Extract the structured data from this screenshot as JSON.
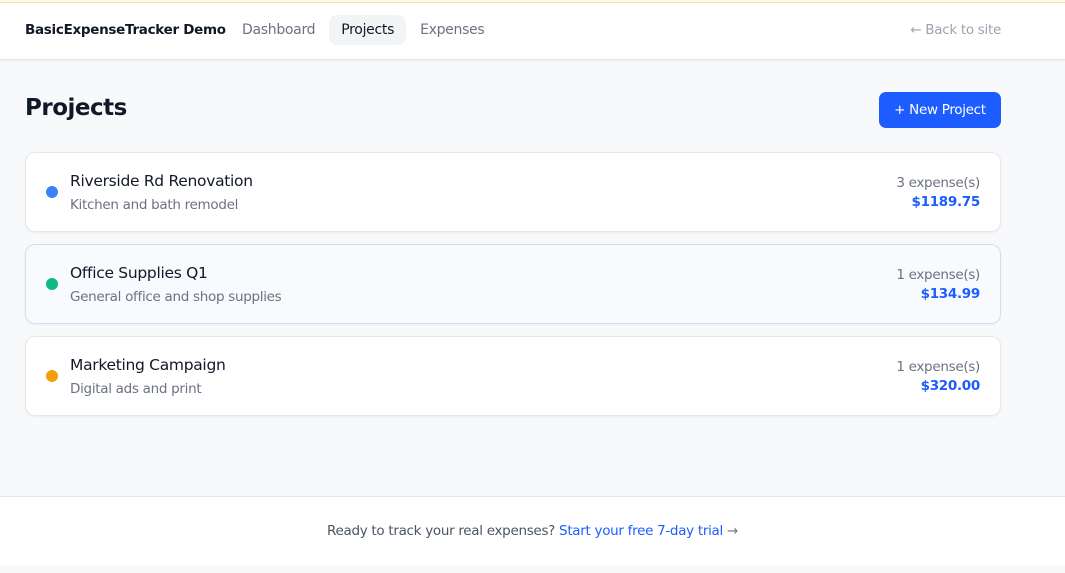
{
  "header": {
    "brand": "BasicExpenseTracker Demo",
    "nav": [
      "Dashboard",
      "Projects",
      "Expenses"
    ],
    "back": "← Back to site"
  },
  "page": {
    "title": "Projects",
    "new_button": "+ New Project"
  },
  "projects": [
    {
      "name": "Riverside Rd Renovation",
      "description": "Kitchen and bath remodel",
      "count": "3 expense(s)",
      "total": "$1189.75",
      "color": "#3b82f6"
    },
    {
      "name": "Office Supplies Q1",
      "description": "General office and shop supplies",
      "count": "1 expense(s)",
      "total": "$134.99",
      "color": "#10b981"
    },
    {
      "name": "Marketing Campaign",
      "description": "Digital ads and print",
      "count": "1 expense(s)",
      "total": "$320.00",
      "color": "#f59e0b"
    }
  ],
  "footer": {
    "text": "Ready to track your real expenses? ",
    "link": "Start your free 7-day trial",
    "arrow": " →"
  }
}
